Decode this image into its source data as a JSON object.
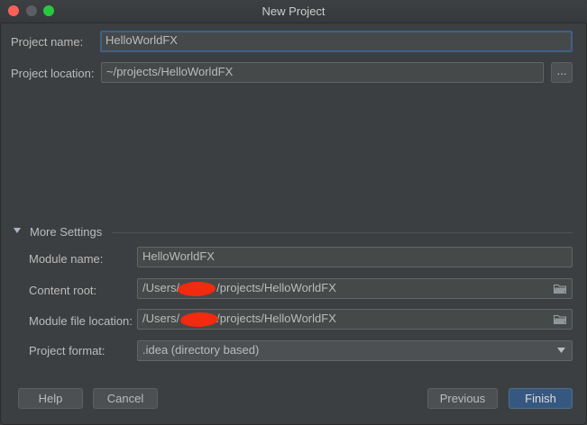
{
  "window": {
    "title": "New Project"
  },
  "project": {
    "name_label": "Project name:",
    "name_value": "HelloWorldFX",
    "location_label": "Project location:",
    "location_value": "~/projects/HelloWorldFX",
    "browse_label": "..."
  },
  "more_settings": {
    "header": "More Settings",
    "module_name_label": "Module name:",
    "module_name_value": "HelloWorldFX",
    "content_root_label": "Content root:",
    "content_root_prefix": "/Users/",
    "content_root_suffix": "/projects/HelloWorldFX",
    "module_file_label": "Module file location:",
    "module_file_prefix": "/Users/",
    "module_file_suffix": "/projects/HelloWorldFX",
    "format_label": "Project format:",
    "format_value": ".idea (directory based)"
  },
  "buttons": {
    "help": "Help",
    "cancel": "Cancel",
    "previous": "Previous",
    "finish": "Finish"
  },
  "colors": {
    "background": "#3c3f41",
    "field_bg": "#45494a",
    "focus_border": "#3d6185",
    "primary_button": "#365880",
    "redaction": "#f22a10"
  }
}
